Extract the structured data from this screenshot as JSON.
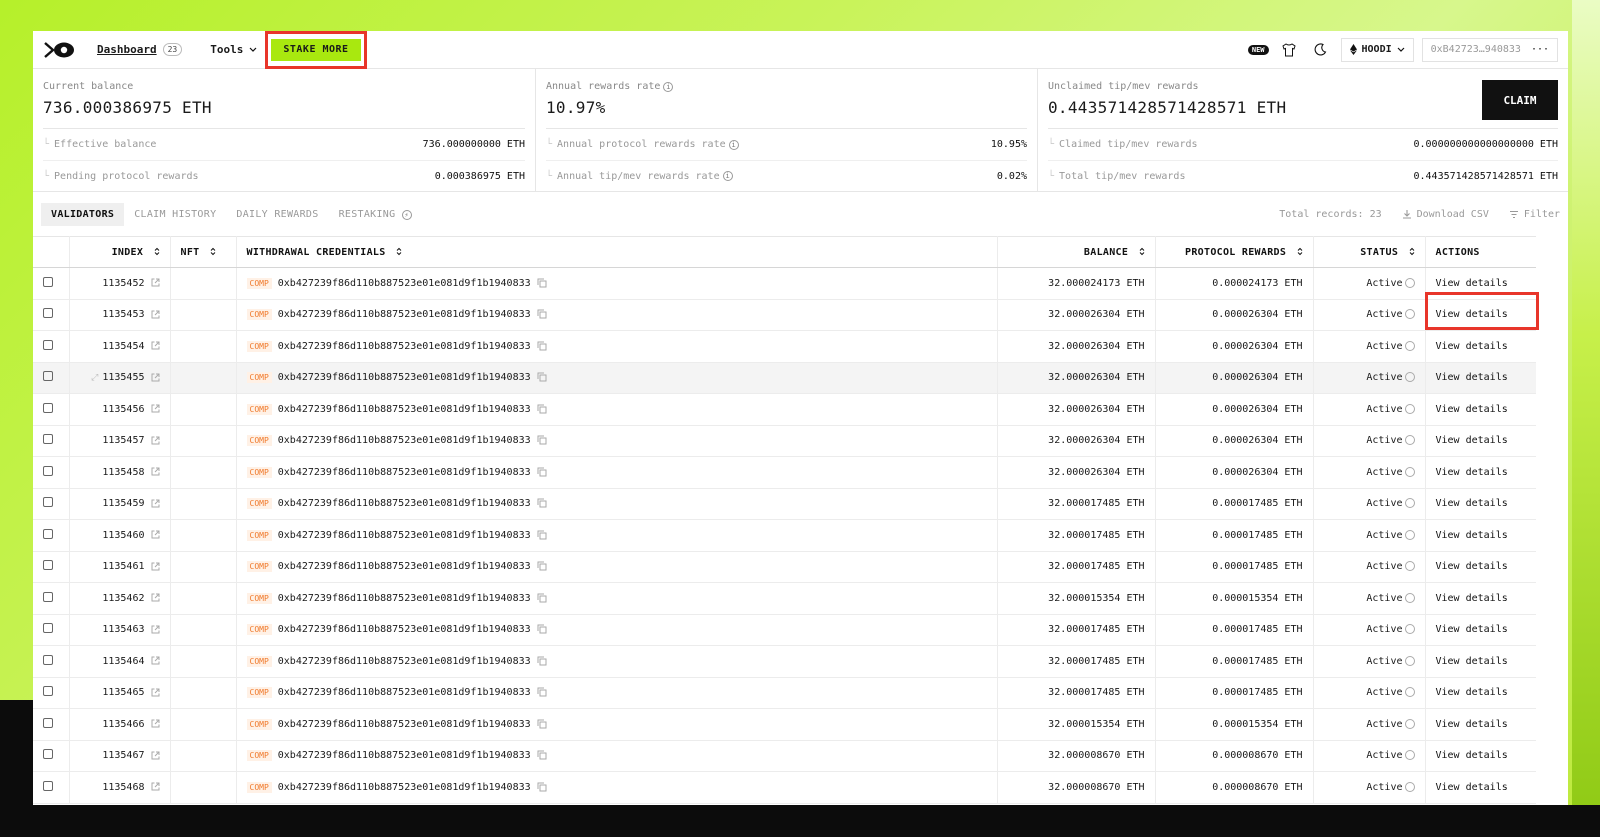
{
  "nav": {
    "dashboard_label": "Dashboard",
    "dashboard_count": "23",
    "tools_label": "Tools",
    "stake_more_label": "STAKE MORE",
    "new_badge": "NEW",
    "network_label": "HOODI",
    "wallet_address": "0xB42723…940833",
    "more_label": "···"
  },
  "stats": {
    "balance": {
      "label": "Current balance",
      "value": "736.000386975 ETH",
      "rows": [
        {
          "label": "Effective balance",
          "value": "736.000000000 ETH"
        },
        {
          "label": "Pending protocol rewards",
          "value": "0.000386975 ETH"
        }
      ]
    },
    "rewards_rate": {
      "label": "Annual rewards rate",
      "value": "10.97%",
      "rows": [
        {
          "label": "Annual protocol rewards rate",
          "value": "10.95%"
        },
        {
          "label": "Annual tip/mev rewards rate",
          "value": "0.02%"
        }
      ]
    },
    "tips": {
      "label": "Unclaimed tip/mev rewards",
      "value": "0.443571428571428571 ETH",
      "claim_label": "CLAIM",
      "rows": [
        {
          "label": "Claimed tip/mev rewards",
          "value": "0.000000000000000000 ETH"
        },
        {
          "label": "Total tip/mev rewards",
          "value": "0.443571428571428571 ETH"
        }
      ]
    }
  },
  "tabs": {
    "items": [
      "VALIDATORS",
      "CLAIM HISTORY",
      "DAILY REWARDS",
      "RESTAKING"
    ],
    "total_records": "Total records: 23",
    "download_csv": "Download CSV",
    "filter": "Filter"
  },
  "table": {
    "headers": {
      "index": "INDEX",
      "nft": "NFT",
      "credentials": "WITHDRAWAL CREDENTIALS",
      "balance": "BALANCE",
      "protocol_rewards": "PROTOCOL REWARDS",
      "status": "STATUS",
      "actions": "ACTIONS"
    },
    "comp_tag": "COMP",
    "action_label": "View details",
    "rows": [
      {
        "index": "1135452",
        "credentials": "0xb427239f86d110b887523e01e081d9f1b1940833",
        "balance": "32.000024173 ETH",
        "rewards": "0.000024173 ETH",
        "status": "Active"
      },
      {
        "index": "1135453",
        "credentials": "0xb427239f86d110b887523e01e081d9f1b1940833",
        "balance": "32.000026304 ETH",
        "rewards": "0.000026304 ETH",
        "status": "Active"
      },
      {
        "index": "1135454",
        "credentials": "0xb427239f86d110b887523e01e081d9f1b1940833",
        "balance": "32.000026304 ETH",
        "rewards": "0.000026304 ETH",
        "status": "Active"
      },
      {
        "index": "1135455",
        "credentials": "0xb427239f86d110b887523e01e081d9f1b1940833",
        "balance": "32.000026304 ETH",
        "rewards": "0.000026304 ETH",
        "status": "Active"
      },
      {
        "index": "1135456",
        "credentials": "0xb427239f86d110b887523e01e081d9f1b1940833",
        "balance": "32.000026304 ETH",
        "rewards": "0.000026304 ETH",
        "status": "Active"
      },
      {
        "index": "1135457",
        "credentials": "0xb427239f86d110b887523e01e081d9f1b1940833",
        "balance": "32.000026304 ETH",
        "rewards": "0.000026304 ETH",
        "status": "Active"
      },
      {
        "index": "1135458",
        "credentials": "0xb427239f86d110b887523e01e081d9f1b1940833",
        "balance": "32.000026304 ETH",
        "rewards": "0.000026304 ETH",
        "status": "Active"
      },
      {
        "index": "1135459",
        "credentials": "0xb427239f86d110b887523e01e081d9f1b1940833",
        "balance": "32.000017485 ETH",
        "rewards": "0.000017485 ETH",
        "status": "Active"
      },
      {
        "index": "1135460",
        "credentials": "0xb427239f86d110b887523e01e081d9f1b1940833",
        "balance": "32.000017485 ETH",
        "rewards": "0.000017485 ETH",
        "status": "Active"
      },
      {
        "index": "1135461",
        "credentials": "0xb427239f86d110b887523e01e081d9f1b1940833",
        "balance": "32.000017485 ETH",
        "rewards": "0.000017485 ETH",
        "status": "Active"
      },
      {
        "index": "1135462",
        "credentials": "0xb427239f86d110b887523e01e081d9f1b1940833",
        "balance": "32.000015354 ETH",
        "rewards": "0.000015354 ETH",
        "status": "Active"
      },
      {
        "index": "1135463",
        "credentials": "0xb427239f86d110b887523e01e081d9f1b1940833",
        "balance": "32.000017485 ETH",
        "rewards": "0.000017485 ETH",
        "status": "Active"
      },
      {
        "index": "1135464",
        "credentials": "0xb427239f86d110b887523e01e081d9f1b1940833",
        "balance": "32.000017485 ETH",
        "rewards": "0.000017485 ETH",
        "status": "Active"
      },
      {
        "index": "1135465",
        "credentials": "0xb427239f86d110b887523e01e081d9f1b1940833",
        "balance": "32.000017485 ETH",
        "rewards": "0.000017485 ETH",
        "status": "Active"
      },
      {
        "index": "1135466",
        "credentials": "0xb427239f86d110b887523e01e081d9f1b1940833",
        "balance": "32.000015354 ETH",
        "rewards": "0.000015354 ETH",
        "status": "Active"
      },
      {
        "index": "1135467",
        "credentials": "0xb427239f86d110b887523e01e081d9f1b1940833",
        "balance": "32.000008670 ETH",
        "rewards": "0.000008670 ETH",
        "status": "Active"
      },
      {
        "index": "1135468",
        "credentials": "0xb427239f86d110b887523e01e081d9f1b1940833",
        "balance": "32.000008670 ETH",
        "rewards": "0.000008670 ETH",
        "status": "Active"
      }
    ]
  },
  "colors": {
    "accent_green": "#a9e80f",
    "highlight_red": "#e8352a",
    "comp_orange": "#f07a2c"
  }
}
